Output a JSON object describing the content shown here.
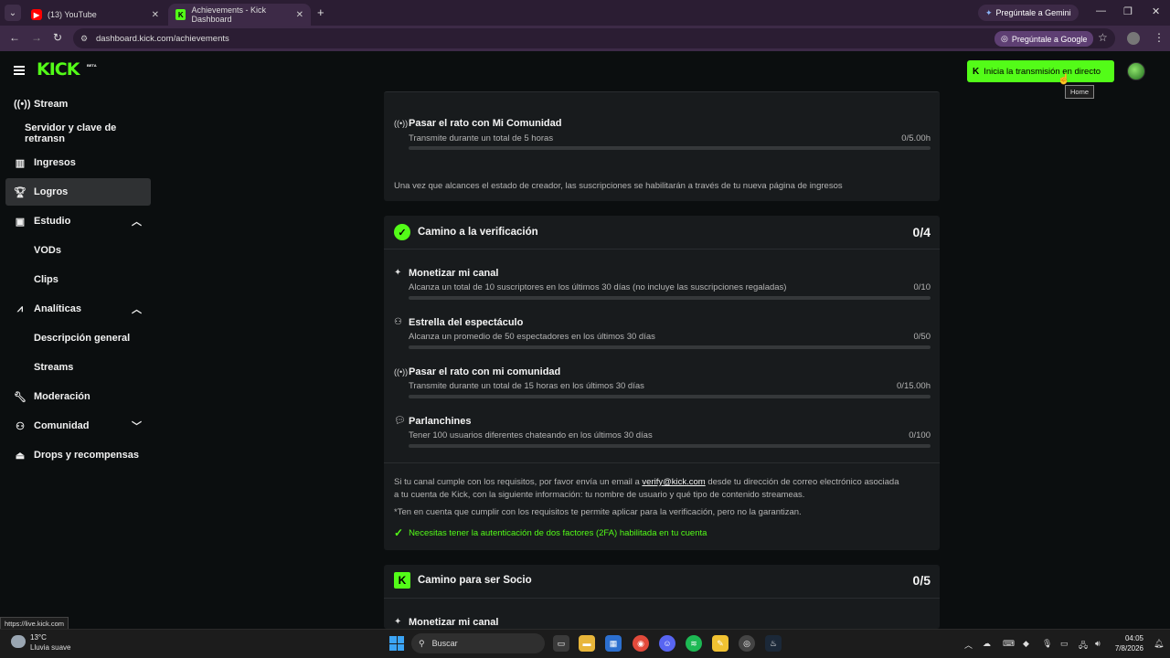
{
  "browser": {
    "tabs": [
      {
        "title": "(13) YouTube"
      },
      {
        "title": "Achievements - Kick Dashboard"
      }
    ],
    "gemini_label": "Pregúntale a Gemini",
    "url": "dashboard.kick.com/achievements",
    "ask_google_label": "Pregúntale a Google"
  },
  "header": {
    "logo": "KICK",
    "beta": "BETA",
    "go_live_label": "Inicia la transmisión en directo",
    "tooltip": "Home"
  },
  "sidebar": {
    "items": [
      {
        "label": "Stream",
        "icon": "broadcast-icon"
      },
      {
        "label": "Servidor y clave de retransn"
      },
      {
        "label": "Ingresos",
        "icon": "chart-icon"
      },
      {
        "label": "Logros",
        "icon": "trophy-icon"
      },
      {
        "label": "Estudio",
        "icon": "studio-icon"
      },
      {
        "label": "VODs"
      },
      {
        "label": "Clips"
      },
      {
        "label": "Analíticas",
        "icon": "analytics-icon"
      },
      {
        "label": "Descripción general"
      },
      {
        "label": "Streams"
      },
      {
        "label": "Moderación",
        "icon": "wrench-icon"
      },
      {
        "label": "Comunidad",
        "icon": "community-icon"
      },
      {
        "label": "Drops y recompensas",
        "icon": "drops-icon"
      }
    ]
  },
  "creator_section": {
    "achievement": {
      "title": "Pasar el rato con Mi Comunidad",
      "desc": "Transmite durante un total de 5 horas",
      "value": "0/5.00h",
      "progress": 0
    },
    "note": "Una vez que alcances el estado de creador, las suscripciones se habilitarán a través de tu nueva página de ingresos"
  },
  "verification_section": {
    "title": "Camino a la verificación",
    "count": "0/4",
    "achievements": [
      {
        "title": "Monetizar mi canal",
        "desc": "Alcanza un total de 10 suscriptores en los últimos 30 días (no incluye las suscripciones regaladas)",
        "value": "0/10",
        "progress": 0
      },
      {
        "title": "Estrella del espectáculo",
        "desc": "Alcanza un promedio de 50 espectadores en los últimos 30 días",
        "value": "0/50",
        "progress": 0
      },
      {
        "title": "Pasar el rato con mi comunidad",
        "desc": "Transmite durante un total de 15 horas en los últimos 30 días",
        "value": "0/15.00h",
        "progress": 0
      },
      {
        "title": "Parlanchines",
        "desc": "Tener 100 usuarios diferentes chateando en los últimos 30 días",
        "value": "0/100",
        "progress": 0
      }
    ],
    "note_line1_pre": "Si tu canal cumple con los requisitos, por favor envía un email a ",
    "note_email": "verify@kick.com",
    "note_line1_post": " desde tu dirección de correo electrónico asociada",
    "note_line2": "a tu cuenta de Kick, con la siguiente información: tu nombre de usuario y qué tipo de contenido streameas.",
    "disclaimer": "*Ten en cuenta que cumplir con los requisitos te permite aplicar para la verificación, pero no la garantizan.",
    "twofa": "Necesitas tener la autenticación de dos factores (2FA) habilitada en tu cuenta"
  },
  "partner_section": {
    "title": "Camino para ser Socio",
    "count": "0/5",
    "first_achievement": "Monetizar mi canal"
  },
  "status_url": "https://live.kick.com",
  "taskbar": {
    "temp": "13°C",
    "weather": "Lluvia suave",
    "search_placeholder": "Buscar",
    "time": "04:05",
    "date": "7/8/2026"
  },
  "colors": {
    "accent": "#53fc18",
    "background": "#0b0e0f",
    "card": "#181b1d"
  }
}
